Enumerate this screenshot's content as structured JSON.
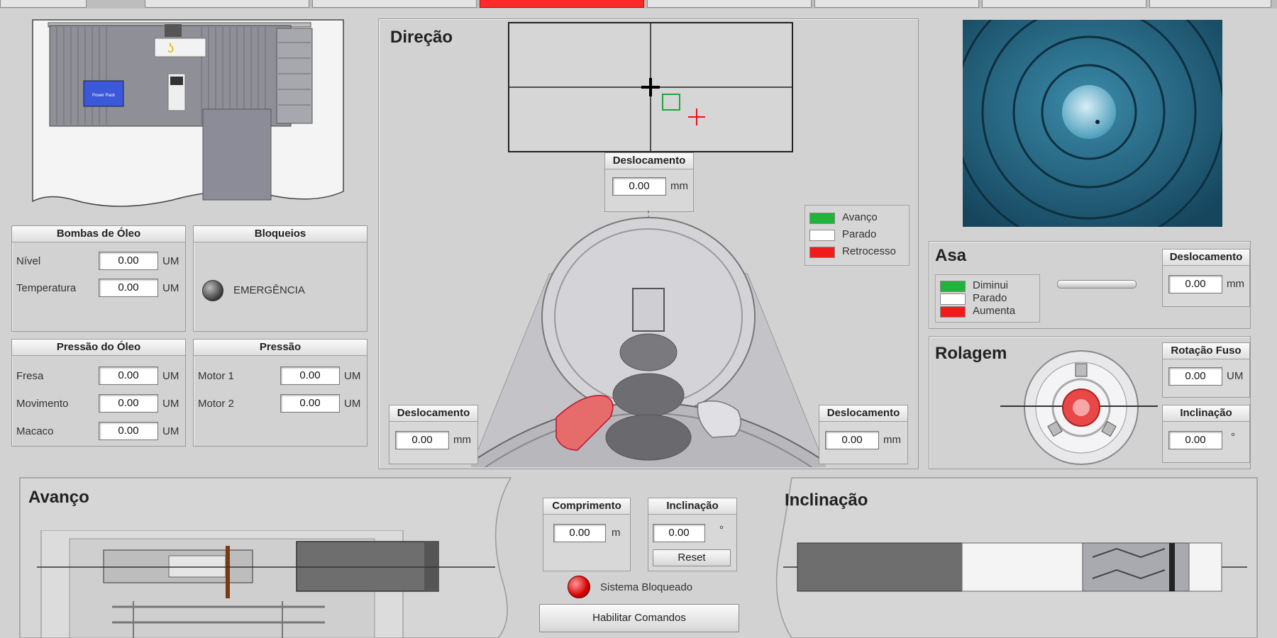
{
  "direcao": {
    "title": "Direção",
    "top_disp": {
      "label": "Deslocamento",
      "value": "0.00",
      "unit": "mm"
    },
    "left_disp": {
      "label": "Deslocamento",
      "value": "0.00",
      "unit": "mm"
    },
    "right_disp": {
      "label": "Deslocamento",
      "value": "0.00",
      "unit": "mm"
    },
    "legend": [
      "Avanço",
      "Parado",
      "Retrocesso"
    ]
  },
  "bombas": {
    "title": "Bombas de Óleo",
    "rows": [
      {
        "label": "Nível",
        "value": "0.00",
        "unit": "UM"
      },
      {
        "label": "Temperatura",
        "value": "0.00",
        "unit": "UM"
      }
    ]
  },
  "bloqueios": {
    "title": "Bloqueios",
    "emergencia": "EMERGÊNCIA"
  },
  "pressao_oleo": {
    "title": "Pressão do Óleo",
    "rows": [
      {
        "label": "Fresa",
        "value": "0.00",
        "unit": "UM"
      },
      {
        "label": "Movimento",
        "value": "0.00",
        "unit": "UM"
      },
      {
        "label": "Macaco",
        "value": "0.00",
        "unit": "UM"
      }
    ]
  },
  "pressao": {
    "title": "Pressão",
    "rows": [
      {
        "label": "Motor 1",
        "value": "0.00",
        "unit": "UM"
      },
      {
        "label": "Motor 2",
        "value": "0.00",
        "unit": "UM"
      }
    ]
  },
  "asa": {
    "title": "Asa",
    "legend": [
      "Diminui",
      "Parado",
      "Aumenta"
    ],
    "disp": {
      "label": "Deslocamento",
      "value": "0.00",
      "unit": "mm"
    }
  },
  "rolagem": {
    "title": "Rolagem",
    "rotacao": {
      "label": "Rotação Fuso",
      "value": "0.00",
      "unit": "UM"
    },
    "inclinacao": {
      "label": "Inclinação",
      "value": "0.00",
      "unit": "°"
    }
  },
  "avanco": {
    "title": "Avanço"
  },
  "center": {
    "comprimento": {
      "label": "Comprimento",
      "value": "0.00",
      "unit": "m"
    },
    "inclinacao": {
      "label": "Inclinação",
      "value": "0.00",
      "unit": "°"
    },
    "reset": "Reset",
    "status": "Sistema Bloqueado",
    "habilitar": "Habilitar Comandos"
  },
  "inclinacao": {
    "title": "Inclinação"
  },
  "machine_label": "Power Pack",
  "colors": {
    "avanco": "#22b33a",
    "parado": "#ffffff",
    "retrocesso": "#ee1c1c",
    "sonar": "#1f5a78",
    "tab_active": "#ff2a2a"
  }
}
